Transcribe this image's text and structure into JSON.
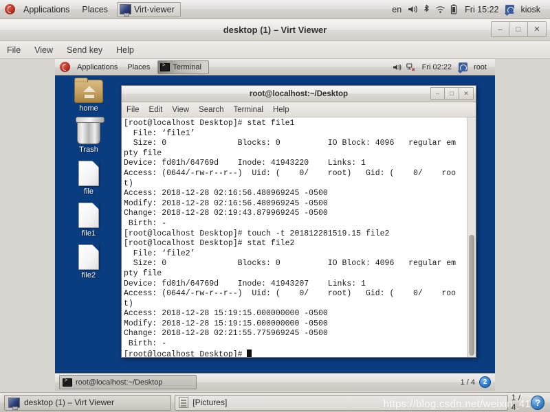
{
  "host_panel": {
    "logo_icon": "fedora-logo-icon",
    "menus": [
      "Applications",
      "Places"
    ],
    "task_button": {
      "label": "Virt-viewer",
      "icon": "virt-viewer-icon"
    },
    "tray": {
      "keyboard_layout": "en",
      "volume_icon": "speaker-icon",
      "bluetooth_icon": "bluetooth-icon",
      "wifi_icon": "wifi-icon",
      "battery_icon": "battery-icon",
      "clock": "Fri 15:22",
      "user_icon": "user-icon",
      "user": "kiosk"
    }
  },
  "viewer_window": {
    "title": "desktop (1) – Virt Viewer",
    "controls": {
      "minimize": "–",
      "maximize": "□",
      "close": "✕"
    },
    "menus": [
      "File",
      "View",
      "Send key",
      "Help"
    ]
  },
  "guest": {
    "panel": {
      "logo_icon": "fedora-logo-icon",
      "menus": [
        "Applications",
        "Places"
      ],
      "task_button": {
        "label": "Terminal",
        "icon": "terminal-icon"
      },
      "tray": {
        "volume_icon": "speaker-icon",
        "network_icon": "network-disconnected-icon",
        "clock": "Fri 02:22",
        "user_icon": "user-icon",
        "user": "root"
      }
    },
    "desktop_icons": [
      {
        "label": "home",
        "icon": "home-folder-icon"
      },
      {
        "label": "Trash",
        "icon": "trash-icon"
      },
      {
        "label": "file",
        "icon": "file-icon"
      },
      {
        "label": "file1",
        "icon": "file-icon"
      },
      {
        "label": "file2",
        "icon": "file-icon"
      }
    ],
    "taskbar": {
      "item": {
        "label": "root@localhost:~/Desktop",
        "icon": "terminal-icon"
      },
      "workspace_counter": "1 / 4",
      "workspace_badge": "2"
    }
  },
  "terminal": {
    "title": "root@localhost:~/Desktop",
    "controls": {
      "minimize": "–",
      "maximize": "□",
      "close": "✕"
    },
    "menus": [
      "File",
      "Edit",
      "View",
      "Search",
      "Terminal",
      "Help"
    ],
    "content": "[root@localhost Desktop]# stat file1\n  File: ‘file1’\n  Size: 0               Blocks: 0          IO Block: 4096   regular em\npty file\nDevice: fd01h/64769d    Inode: 41943220    Links: 1\nAccess: (0644/-rw-r--r--)  Uid: (    0/    root)   Gid: (    0/    roo\nt)\nAccess: 2018-12-28 02:16:56.480969245 -0500\nModify: 2018-12-28 02:16:56.480969245 -0500\nChange: 2018-12-28 02:19:43.879969245 -0500\n Birth: -\n[root@localhost Desktop]# touch -t 201812281519.15 file2\n[root@localhost Desktop]# stat file2\n  File: ‘file2’\n  Size: 0               Blocks: 0          IO Block: 4096   regular em\npty file\nDevice: fd01h/64769d    Inode: 41943207    Links: 1\nAccess: (0644/-rw-r--r--)  Uid: (    0/    root)   Gid: (    0/    roo\nt)\nAccess: 2018-12-28 15:19:15.000000000 -0500\nModify: 2018-12-28 15:19:15.000000000 -0500\nChange: 2018-12-28 02:21:55.775969245 -0500\n Birth: -\n[root@localhost Desktop]# ",
    "scrollbar": "vertical-scrollbar"
  },
  "host_taskbar": {
    "items": [
      {
        "label": "desktop (1) – Virt Viewer",
        "icon": "virt-viewer-icon"
      },
      {
        "label": "[Pictures]",
        "icon": "pictures-icon"
      }
    ],
    "workspace_counter": "1 / 4",
    "help_badge": "?"
  },
  "watermark": {
    "text": "https://blog.csdn.net/weixin_41"
  },
  "colors": {
    "desktop_blue": "#0a3c80",
    "panel_grey": "#e0dedb",
    "terminal_bg": "#ffffff",
    "accent_blue": "#2f7fd0"
  }
}
